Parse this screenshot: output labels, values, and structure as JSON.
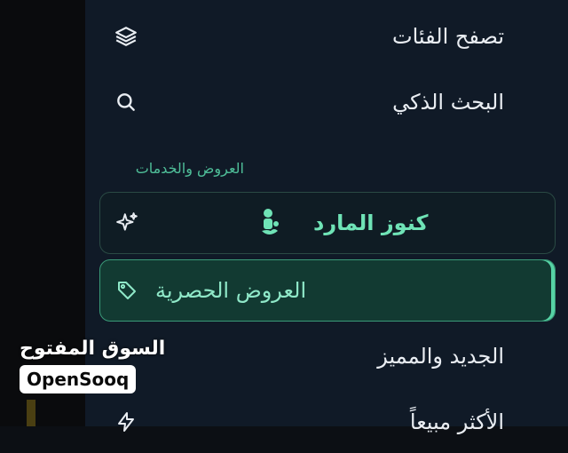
{
  "menu": {
    "browse_categories": "تصفح الفئات",
    "smart_search": "البحث الذكي",
    "offers_section_title": "العروض والخدمات",
    "kunooz_almarid": "كنوز المارد",
    "exclusive_offers": "العروض الحصرية",
    "new_and_featured": "الجديد والمميز",
    "best_selling": "الأكثر مبيعاً"
  },
  "watermark": {
    "arabic": "السوق المفتوح",
    "latin": "OpenSooq"
  },
  "icons": {
    "browse": "layers-icon",
    "search": "search-icon",
    "kunooz": "sparkle-icon",
    "exclusive": "tag-icon",
    "best": "lightning-icon"
  },
  "colors": {
    "drawer_bg": "#101a27",
    "accent": "#56d3a5",
    "section_title": "#4fbf99"
  }
}
